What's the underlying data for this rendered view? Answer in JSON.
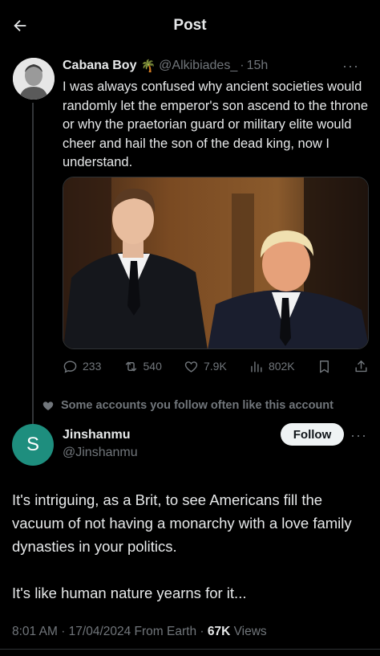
{
  "header": {
    "title": "Post"
  },
  "parent_post": {
    "author_name": "Cabana Boy",
    "badge_emoji": "🌴",
    "handle": "@Alkibiades_",
    "separator": "·",
    "time": "15h",
    "more": "···",
    "text": "I was always confused why ancient societies would randomly let the emperor's son ascend to the throne or why the praetorian guard or military elite would cheer and hail the son of the dead king, now I understand.",
    "actions": {
      "replies": "233",
      "reposts": "540",
      "likes": "7.9K",
      "views": "802K"
    }
  },
  "social_context": "Some accounts you follow often like this account",
  "reply_post": {
    "avatar_letter": "S",
    "author_name": "Jinshanmu",
    "handle": "@Jinshanmu",
    "follow_label": "Follow",
    "more": "···",
    "paragraphs": [
      "It's intriguing, as a Brit, to see Americans fill the vacuum of not having a monarchy with a love family dynasties in your politics.",
      "It's like human nature yearns for it..."
    ],
    "time": "8:01 AM",
    "date": "17/04/2024",
    "source": "From Earth",
    "views_count": "67K",
    "views_label": "Views"
  },
  "colors": {
    "background": "#000000",
    "text_primary": "#e7e9ea",
    "text_secondary": "#71767b",
    "divider": "#2f3336",
    "avatar_teal": "#1e8e7e",
    "follow_bg": "#eff3f4"
  }
}
